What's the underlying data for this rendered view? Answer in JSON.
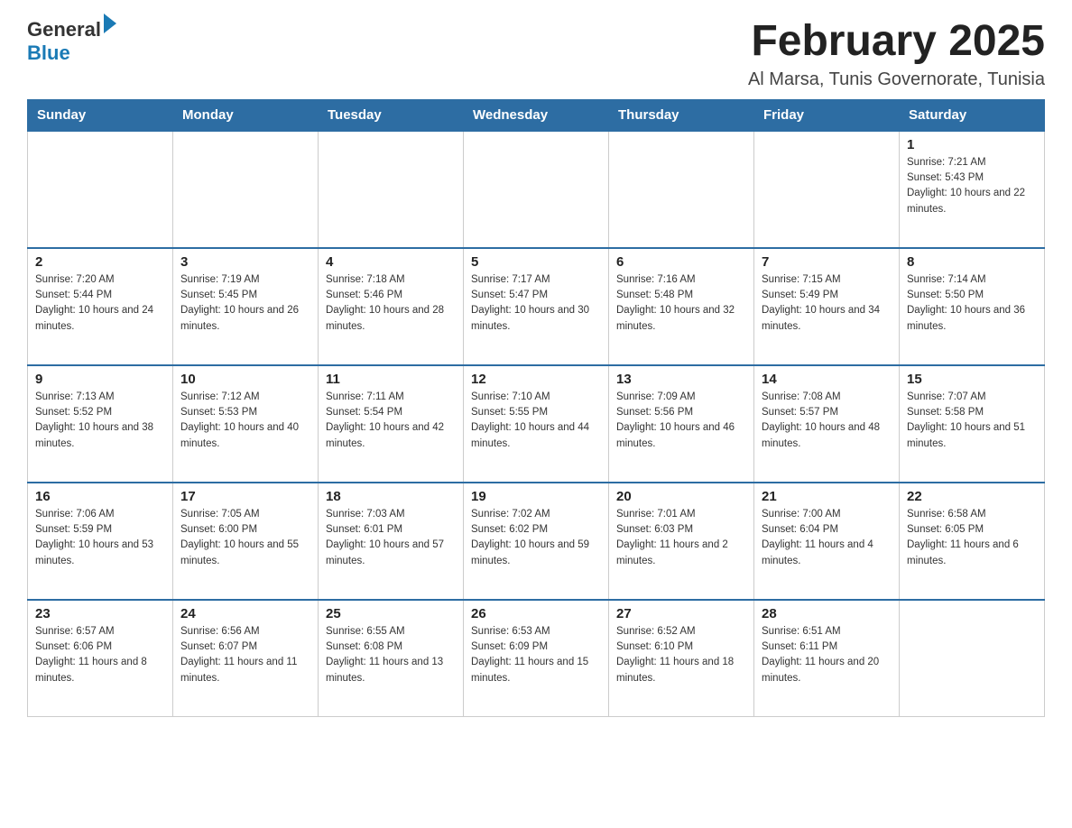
{
  "header": {
    "logo_general": "General",
    "logo_blue": "Blue",
    "month_title": "February 2025",
    "location": "Al Marsa, Tunis Governorate, Tunisia"
  },
  "weekdays": [
    "Sunday",
    "Monday",
    "Tuesday",
    "Wednesday",
    "Thursday",
    "Friday",
    "Saturday"
  ],
  "weeks": [
    [
      {
        "day": "",
        "info": ""
      },
      {
        "day": "",
        "info": ""
      },
      {
        "day": "",
        "info": ""
      },
      {
        "day": "",
        "info": ""
      },
      {
        "day": "",
        "info": ""
      },
      {
        "day": "",
        "info": ""
      },
      {
        "day": "1",
        "info": "Sunrise: 7:21 AM\nSunset: 5:43 PM\nDaylight: 10 hours and 22 minutes."
      }
    ],
    [
      {
        "day": "2",
        "info": "Sunrise: 7:20 AM\nSunset: 5:44 PM\nDaylight: 10 hours and 24 minutes."
      },
      {
        "day": "3",
        "info": "Sunrise: 7:19 AM\nSunset: 5:45 PM\nDaylight: 10 hours and 26 minutes."
      },
      {
        "day": "4",
        "info": "Sunrise: 7:18 AM\nSunset: 5:46 PM\nDaylight: 10 hours and 28 minutes."
      },
      {
        "day": "5",
        "info": "Sunrise: 7:17 AM\nSunset: 5:47 PM\nDaylight: 10 hours and 30 minutes."
      },
      {
        "day": "6",
        "info": "Sunrise: 7:16 AM\nSunset: 5:48 PM\nDaylight: 10 hours and 32 minutes."
      },
      {
        "day": "7",
        "info": "Sunrise: 7:15 AM\nSunset: 5:49 PM\nDaylight: 10 hours and 34 minutes."
      },
      {
        "day": "8",
        "info": "Sunrise: 7:14 AM\nSunset: 5:50 PM\nDaylight: 10 hours and 36 minutes."
      }
    ],
    [
      {
        "day": "9",
        "info": "Sunrise: 7:13 AM\nSunset: 5:52 PM\nDaylight: 10 hours and 38 minutes."
      },
      {
        "day": "10",
        "info": "Sunrise: 7:12 AM\nSunset: 5:53 PM\nDaylight: 10 hours and 40 minutes."
      },
      {
        "day": "11",
        "info": "Sunrise: 7:11 AM\nSunset: 5:54 PM\nDaylight: 10 hours and 42 minutes."
      },
      {
        "day": "12",
        "info": "Sunrise: 7:10 AM\nSunset: 5:55 PM\nDaylight: 10 hours and 44 minutes."
      },
      {
        "day": "13",
        "info": "Sunrise: 7:09 AM\nSunset: 5:56 PM\nDaylight: 10 hours and 46 minutes."
      },
      {
        "day": "14",
        "info": "Sunrise: 7:08 AM\nSunset: 5:57 PM\nDaylight: 10 hours and 48 minutes."
      },
      {
        "day": "15",
        "info": "Sunrise: 7:07 AM\nSunset: 5:58 PM\nDaylight: 10 hours and 51 minutes."
      }
    ],
    [
      {
        "day": "16",
        "info": "Sunrise: 7:06 AM\nSunset: 5:59 PM\nDaylight: 10 hours and 53 minutes."
      },
      {
        "day": "17",
        "info": "Sunrise: 7:05 AM\nSunset: 6:00 PM\nDaylight: 10 hours and 55 minutes."
      },
      {
        "day": "18",
        "info": "Sunrise: 7:03 AM\nSunset: 6:01 PM\nDaylight: 10 hours and 57 minutes."
      },
      {
        "day": "19",
        "info": "Sunrise: 7:02 AM\nSunset: 6:02 PM\nDaylight: 10 hours and 59 minutes."
      },
      {
        "day": "20",
        "info": "Sunrise: 7:01 AM\nSunset: 6:03 PM\nDaylight: 11 hours and 2 minutes."
      },
      {
        "day": "21",
        "info": "Sunrise: 7:00 AM\nSunset: 6:04 PM\nDaylight: 11 hours and 4 minutes."
      },
      {
        "day": "22",
        "info": "Sunrise: 6:58 AM\nSunset: 6:05 PM\nDaylight: 11 hours and 6 minutes."
      }
    ],
    [
      {
        "day": "23",
        "info": "Sunrise: 6:57 AM\nSunset: 6:06 PM\nDaylight: 11 hours and 8 minutes."
      },
      {
        "day": "24",
        "info": "Sunrise: 6:56 AM\nSunset: 6:07 PM\nDaylight: 11 hours and 11 minutes."
      },
      {
        "day": "25",
        "info": "Sunrise: 6:55 AM\nSunset: 6:08 PM\nDaylight: 11 hours and 13 minutes."
      },
      {
        "day": "26",
        "info": "Sunrise: 6:53 AM\nSunset: 6:09 PM\nDaylight: 11 hours and 15 minutes."
      },
      {
        "day": "27",
        "info": "Sunrise: 6:52 AM\nSunset: 6:10 PM\nDaylight: 11 hours and 18 minutes."
      },
      {
        "day": "28",
        "info": "Sunrise: 6:51 AM\nSunset: 6:11 PM\nDaylight: 11 hours and 20 minutes."
      },
      {
        "day": "",
        "info": ""
      }
    ]
  ]
}
